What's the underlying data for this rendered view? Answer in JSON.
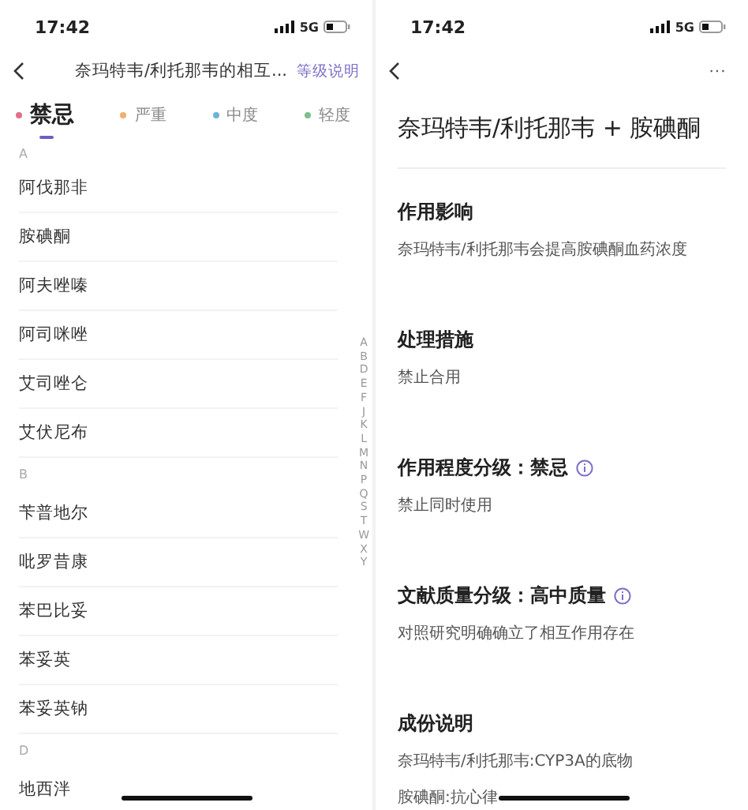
{
  "screens": [
    {
      "status": {
        "time": "17:42",
        "network": "5G"
      },
      "nav": {
        "title": "奈玛特韦/利托那韦的相互...",
        "action": "等级说明"
      },
      "tabs": [
        {
          "label": "禁忌",
          "color": "#e0708a",
          "selected": true
        },
        {
          "label": "严重",
          "color": "#f0b070",
          "selected": false
        },
        {
          "label": "中度",
          "color": "#6cb4d8",
          "selected": false
        },
        {
          "label": "轻度",
          "color": "#7cc08a",
          "selected": false
        }
      ],
      "sections": [
        {
          "letter": "A",
          "items": [
            "阿伐那非",
            "胺碘酮",
            "阿夫唑嗪",
            "阿司咪唑",
            "艾司唑仑",
            "艾伏尼布"
          ]
        },
        {
          "letter": "B",
          "items": [
            "苄普地尔",
            "吡罗昔康",
            "苯巴比妥",
            "苯妥英",
            "苯妥英钠"
          ]
        },
        {
          "letter": "D",
          "items": [
            "地西泮"
          ]
        }
      ],
      "index": [
        "A",
        "B",
        "D",
        "E",
        "F",
        "J",
        "K",
        "L",
        "M",
        "N",
        "P",
        "Q",
        "S",
        "T",
        "W",
        "X",
        "Y"
      ]
    },
    {
      "status": {
        "time": "17:42",
        "network": "5G"
      },
      "nav": {
        "more": "···"
      },
      "title": "奈玛特韦/利托那韦 + 胺碘酮",
      "sections": [
        {
          "heading": "作用影响",
          "info": false,
          "body": [
            "奈玛特韦/利托那韦会提高胺碘酮血药浓度"
          ]
        },
        {
          "heading": "处理措施",
          "info": false,
          "body": [
            "禁止合用"
          ]
        },
        {
          "heading": "作用程度分级：禁忌",
          "info": true,
          "body": [
            "禁止同时使用"
          ]
        },
        {
          "heading": "文献质量分级：高中质量",
          "info": true,
          "body": [
            "对照研究明确确立了相互作用存在"
          ]
        },
        {
          "heading": "成份说明",
          "info": false,
          "body": [
            "奈玛特韦/利托那韦:CYP3A的底物",
            "胺碘酮:抗心律"
          ]
        }
      ]
    }
  ]
}
